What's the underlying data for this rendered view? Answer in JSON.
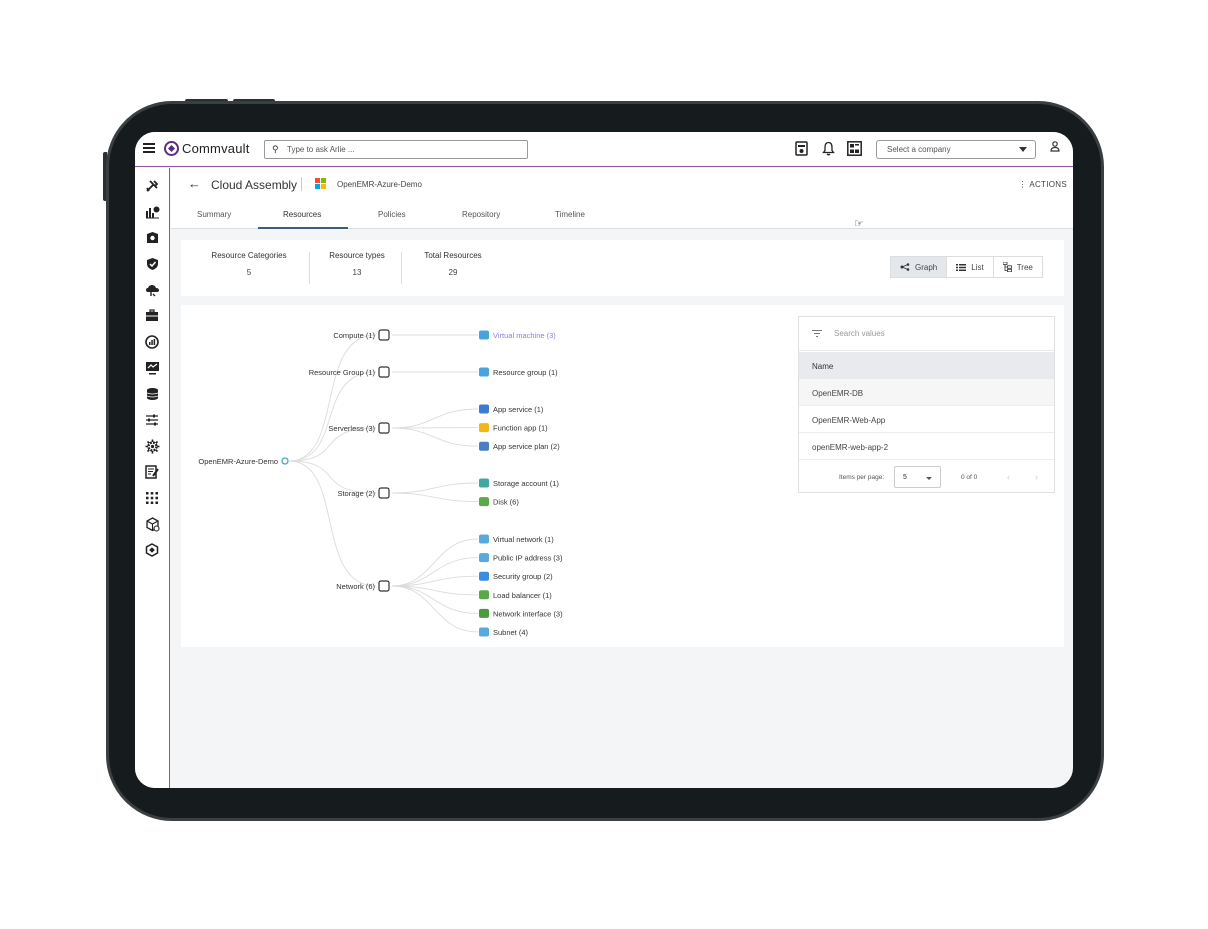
{
  "app": {
    "brand": "Commvault",
    "search_placeholder": "Type to ask Arlie ...",
    "company_placeholder": "Select a company"
  },
  "page": {
    "title": "Cloud Assembly",
    "subtitle": "OpenEMR-Azure-Demo",
    "actions": "ACTIONS"
  },
  "tabs": [
    {
      "label": "Summary",
      "active": false
    },
    {
      "label": "Resources",
      "active": true
    },
    {
      "label": "Policies",
      "active": false
    },
    {
      "label": "Repository",
      "active": false
    },
    {
      "label": "Timeline",
      "active": false
    }
  ],
  "summary": {
    "stats": [
      {
        "label": "Resource Categories",
        "value": "5"
      },
      {
        "label": "Resource types",
        "value": "13"
      },
      {
        "label": "Total Resources",
        "value": "29"
      }
    ]
  },
  "views": [
    {
      "label": "Graph",
      "active": true,
      "icon": "share-icon"
    },
    {
      "label": "List",
      "active": false,
      "icon": "list-icon"
    },
    {
      "label": "Tree",
      "active": false,
      "icon": "tree-icon"
    }
  ],
  "graph": {
    "root": "OpenEMR-Azure-Demo",
    "categories": [
      {
        "label": "Compute (1)",
        "icon": "cpu-icon",
        "leaves": [
          {
            "label": "Virtual machine (3)",
            "icon": "vm-icon",
            "color": "#4aa3df",
            "selected": true
          }
        ]
      },
      {
        "label": "Resource Group (1)",
        "icon": "resource-group-icon",
        "leaves": [
          {
            "label": "Resource group (1)",
            "icon": "resource-group-icon",
            "color": "#4aa3df"
          }
        ]
      },
      {
        "label": "Serverless (3)",
        "icon": "serverless-icon",
        "leaves": [
          {
            "label": "App service (1)",
            "icon": "app-service-icon",
            "color": "#3b7bd4"
          },
          {
            "label": "Function app (1)",
            "icon": "function-icon",
            "color": "#f2b619"
          },
          {
            "label": "App service plan (2)",
            "icon": "app-plan-icon",
            "color": "#4a7fc1"
          }
        ]
      },
      {
        "label": "Storage (2)",
        "icon": "cloud-lock-icon",
        "leaves": [
          {
            "label": "Storage account (1)",
            "icon": "storage-icon",
            "color": "#3fa9a0"
          },
          {
            "label": "Disk (6)",
            "icon": "disk-icon",
            "color": "#5aa84a"
          }
        ]
      },
      {
        "label": "Network (6)",
        "icon": "network-icon",
        "leaves": [
          {
            "label": "Virtual network (1)",
            "icon": "vnet-icon",
            "color": "#5aa9dd"
          },
          {
            "label": "Public IP address (3)",
            "icon": "public-ip-icon",
            "color": "#5aa9dd"
          },
          {
            "label": "Security group (2)",
            "icon": "shield-icon",
            "color": "#3b8be0"
          },
          {
            "label": "Load balancer (1)",
            "icon": "load-balancer-icon",
            "color": "#5aa84a"
          },
          {
            "label": "Network interface (3)",
            "icon": "nic-icon",
            "color": "#4c9a3f"
          },
          {
            "label": "Subnet (4)",
            "icon": "subnet-icon",
            "color": "#5aa9dd"
          }
        ]
      }
    ]
  },
  "table": {
    "search_placeholder": "Search values",
    "column": "Name",
    "rows": [
      "OpenEMR-DB",
      "OpenEMR-Web-App",
      "openEMR-web-app-2"
    ],
    "items_per_page_label": "Items per page:",
    "items_per_page": "5",
    "range": "0 of 0",
    "prev": "‹",
    "next": "›"
  }
}
